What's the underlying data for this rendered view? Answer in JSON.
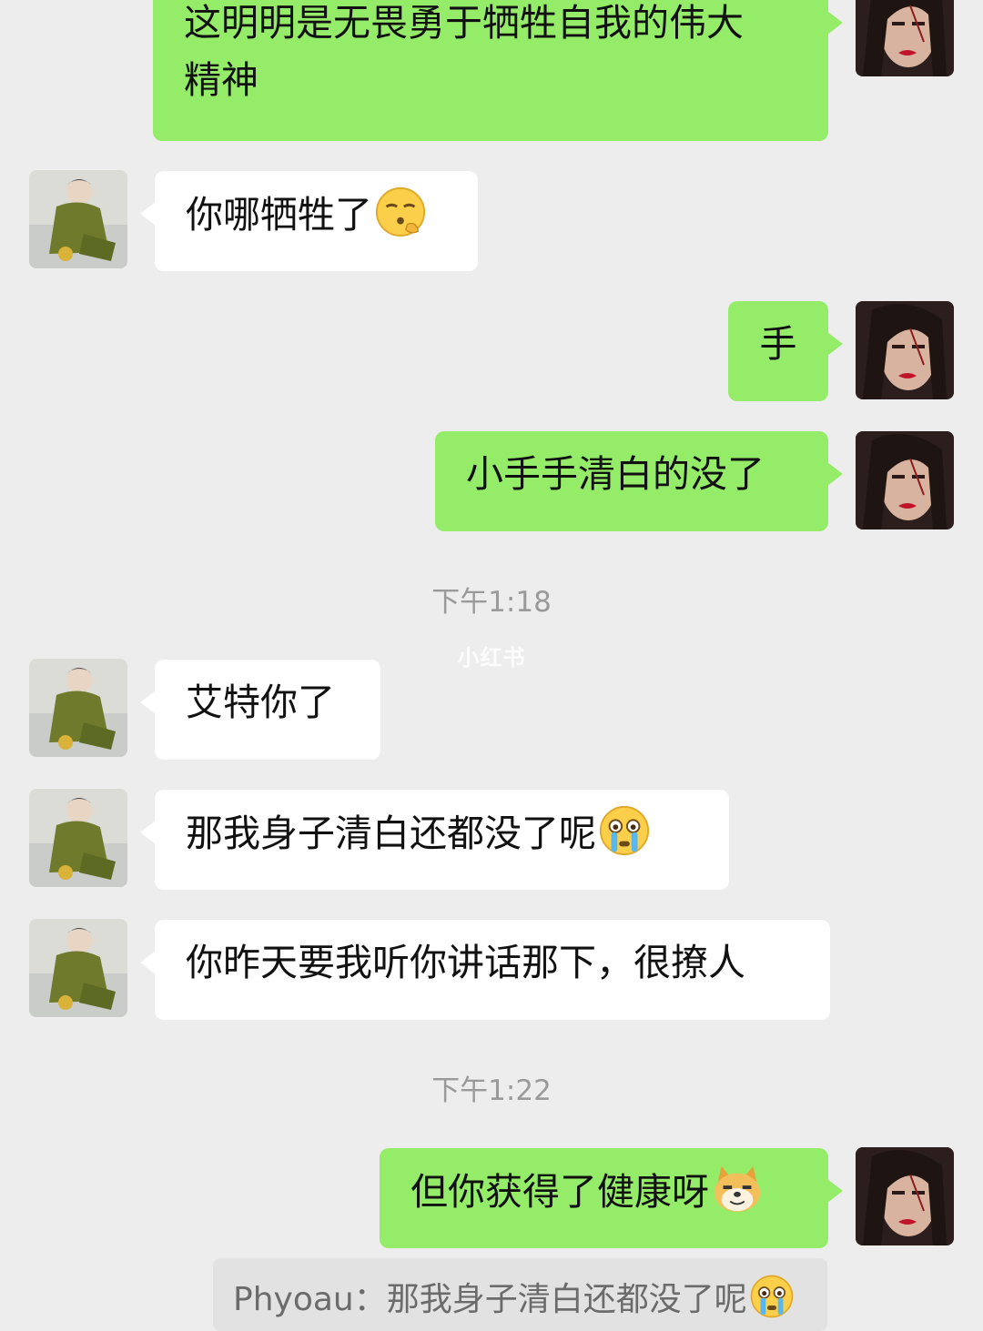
{
  "messages": [
    {
      "text_l1": "这明明是无畏勇于牺牲自我的伟大",
      "text_l2": "精神"
    },
    {
      "text": "你哪牺牲了",
      "emoji": "smirking-face-emoji"
    },
    {
      "text": "手"
    },
    {
      "text": "小手手清白的没了"
    },
    {
      "text": "艾特你了"
    },
    {
      "text": "那我身子清白还都没了呢",
      "emoji": "crying-face-emoji"
    },
    {
      "text": "你昨天要我听你讲话那下，很撩人"
    },
    {
      "text": "但你获得了健康呀",
      "emoji": "doge-emoji"
    }
  ],
  "timestamps": {
    "t1": "下午1:18",
    "t2": "下午1:22"
  },
  "watermark": "小红书",
  "quote": {
    "text": "Phyoau：那我身子清白还都没了呢",
    "emoji": "crying-face-emoji"
  },
  "colors": {
    "background": "#ededed",
    "my_bubble": "#95ec69",
    "their_bubble": "#ffffff"
  }
}
